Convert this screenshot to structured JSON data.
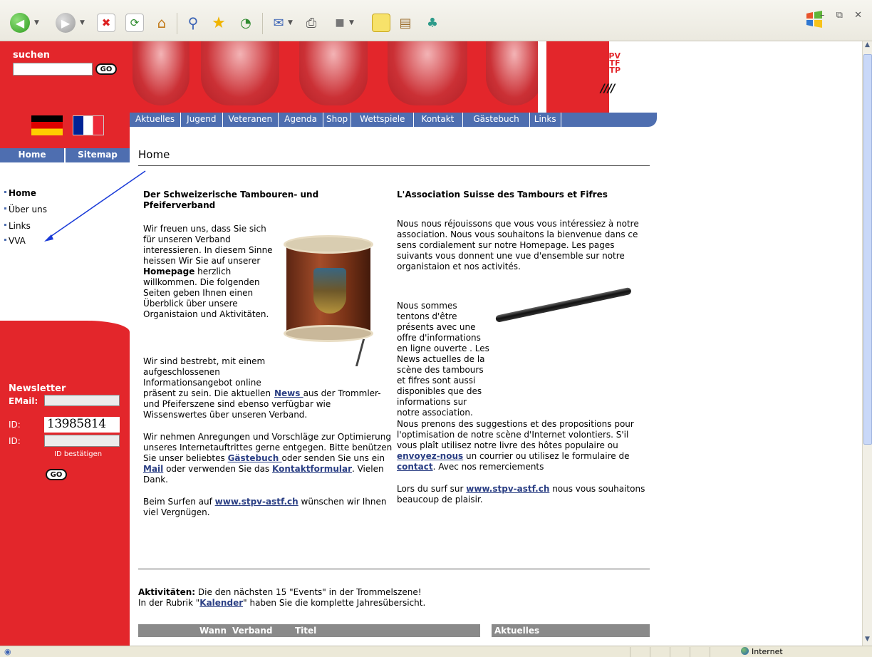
{
  "browser": {
    "window_controls": "– ⧉ ✕",
    "status_zone": "Internet"
  },
  "site": {
    "search_label": "suchen",
    "go_label": "GO",
    "logo_lines": [
      "STPV",
      "ASTF",
      "ASTP"
    ],
    "logo_bars": "////",
    "top_nav": [
      "Aktuelles",
      "Jugend",
      "Veteranen",
      "Agenda",
      "Shop",
      "Wettspiele",
      "Kontakt",
      "Gästebuch",
      "Links"
    ],
    "tabs": {
      "home": "Home",
      "sitemap": "Sitemap"
    },
    "page_heading": "Home",
    "side_menu": [
      "Home",
      "Über uns",
      "Links",
      "VVA"
    ],
    "newsletter": {
      "title": "Newsletter",
      "email_label": "EMail:",
      "id_label": "ID:",
      "captcha": "13985814",
      "id_label2": "ID:",
      "confirm_label": "ID bestätigen"
    }
  },
  "german": {
    "title": "Der Schweizerische Tambouren- und Pfeiferverband",
    "p1_a": "Wir freuen uns, dass Sie sich für unseren Verband interessieren. In diesem Sinne heissen Wir Sie auf unserer ",
    "p1_b": "Homepage",
    "p1_c": " herzlich willkommen. Die folgenden Seiten geben Ihnen einen Überblick über unsere Organistaion und Aktivitäten.",
    "p2_a": "Wir sind bestrebt, mit einem aufgeschlossenen Informationsangebot online präsent zu sein. Die aktuellen ",
    "p2_link": "News ",
    "p2_b": "aus der Trommler- und Pfeiferszene sind ebenso verfügbar wie Wissenswertes über unseren Verband.",
    "p3_a": "Wir nehmen Anregungen und Vorschläge zur Optimierung unseres Internetauftrittes gerne entgegen. Bitte benützen Sie unser beliebtes ",
    "p3_link1": "Gästebuch ",
    "p3_b": "oder senden Sie uns ein ",
    "p3_link2": "Mail",
    "p3_c": " oder verwenden Sie das ",
    "p3_link3": "Kontaktformular",
    "p3_d": ". Vielen Dank.",
    "p4_a": "Beim Surfen auf ",
    "p4_link": "www.stpv-astf.ch",
    "p4_b": " wünschen wir Ihnen viel Vergnügen."
  },
  "french": {
    "title": "L'Association Suisse des Tambours et Fifres",
    "p1": "Nous nous réjouissons que vous vous intéressiez à notre association. Nous vous souhaitons la bienvenue dans ce sens cordialement sur notre Homepage. Les pages suivants vous donnent une vue d'ensemble sur notre organistaion et nos activités.",
    "p2": "Nous sommes tentons d'être présents avec une offre d'informations en ligne ouverte . Les News actuelles de la scène des tambours et fifres sont aussi disponibles que des informations sur notre association.",
    "p3_a": "Nous prenons des suggestions et des propositions pour l'optimisation de notre scène d'Internet volontiers. S'il vous plaît utilisez notre livre des hôtes populaire ou ",
    "p3_link1": "envoyez-nous",
    "p3_b": " un courrier ou utilisez le formulaire de ",
    "p3_link2": "contact",
    "p3_c": ". Avec nos remerciements",
    "p4_a": "Lors du surf sur ",
    "p4_link": "www.stpv-astf.ch",
    "p4_b": " nous vous souhaitons beaucoup de plaisir."
  },
  "activities": {
    "label": "Aktivitäten:",
    "text1": " Die den nächsten 15 \"Events\" in der Trommelszene!",
    "text2_a": "In der Rubrik \"",
    "text2_link": "Kalender",
    "text2_b": "\" haben Sie die komplette Jahresübersicht.",
    "columns": [
      "Wann",
      "Verband",
      "Titel"
    ],
    "news_header": "Aktuelles"
  },
  "colors": {
    "brand_red": "#e3262b",
    "nav_blue": "#4e6eb0",
    "link": "#2b3f84",
    "arrow": "#1a3bd8"
  }
}
